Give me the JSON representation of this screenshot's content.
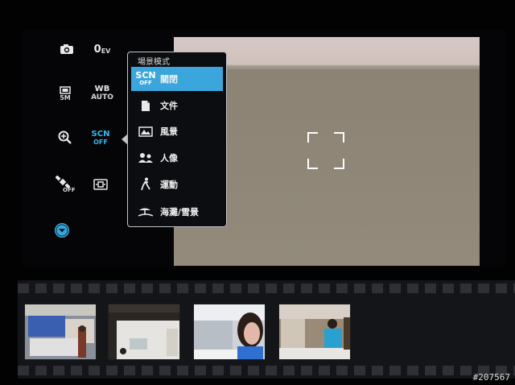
{
  "controls": {
    "ev": {
      "main": "0",
      "sub": "EV"
    },
    "resolution": {
      "main": "5M"
    },
    "white_balance": {
      "main": "WB",
      "sub": "AUTO"
    },
    "scene": {
      "main": "SCN",
      "sub": "OFF"
    },
    "gps": {
      "sub": "OFF"
    }
  },
  "scene_menu": {
    "title": "場景模式",
    "items": [
      {
        "label": "關閉",
        "glyph_main": "SCN",
        "glyph_sub": "OFF",
        "icon": "scn-off-icon",
        "selected": true
      },
      {
        "label": "文件",
        "icon": "document-icon"
      },
      {
        "label": "風景",
        "icon": "landscape-icon"
      },
      {
        "label": "人像",
        "icon": "portrait-icon"
      },
      {
        "label": "運動",
        "icon": "sports-icon"
      },
      {
        "label": "海灘/雪景",
        "icon": "beach-snow-icon"
      }
    ]
  },
  "colors": {
    "accent": "#3aa6dc",
    "active_text": "#38b8f0"
  },
  "watermark": "#207567"
}
